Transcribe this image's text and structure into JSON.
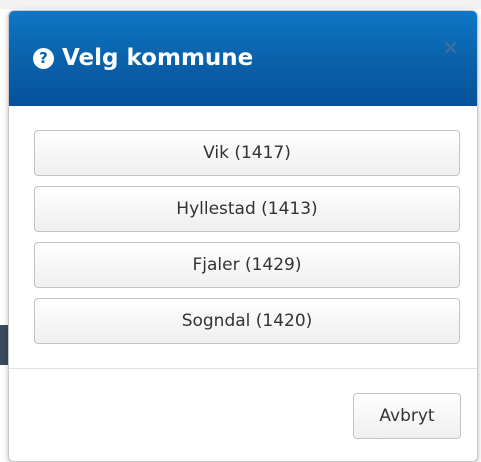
{
  "dialog": {
    "title": "Velg kommune",
    "help_icon_glyph": "?",
    "close_glyph": "×"
  },
  "options": [
    {
      "label": "Vik (1417)"
    },
    {
      "label": "Hyllestad (1413)"
    },
    {
      "label": "Fjaler (1429)"
    },
    {
      "label": "Sogndal (1420)"
    }
  ],
  "footer": {
    "cancel_label": "Avbryt"
  },
  "colors": {
    "header_top": "#0e77c5",
    "header_bottom": "#06519b",
    "button_text": "#333333"
  }
}
